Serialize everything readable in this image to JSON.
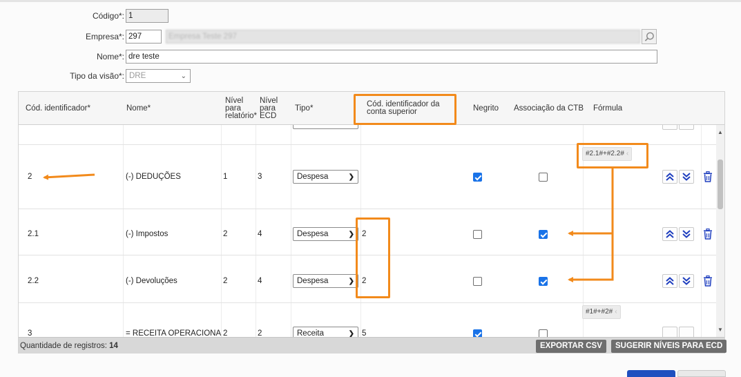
{
  "form": {
    "codigo": {
      "label": "Código*:",
      "value": "1"
    },
    "empresa": {
      "label": "Empresa*:",
      "code": "297",
      "name": "Empresa Teste 297"
    },
    "nome": {
      "label": "Nome*:",
      "value": "dre teste"
    },
    "tipo_visao": {
      "label": "Tipo da visão*:",
      "value": "DRE"
    }
  },
  "grid": {
    "columns": {
      "cod": "Cód. identificador*",
      "nome": "Nome*",
      "nivel_rel_1": "Nível",
      "nivel_rel_2": "para",
      "nivel_rel_3": "relatório*",
      "nivel_ecd_1": "Nível",
      "nivel_ecd_2": "para",
      "nivel_ecd_3": "ECD",
      "tipo": "Tipo*",
      "sup_1": "Cód. identificador da",
      "sup_2": "conta superior",
      "negrito": "Negrito",
      "assoc": "Associação da CTB",
      "formula": "Fórmula"
    },
    "rows": [
      {
        "cod": "2",
        "nome": "(-) DEDUÇÕES",
        "nivel_rel": "1",
        "nivel_ecd": "3",
        "tipo": "Despesa",
        "superior": "",
        "negrito": true,
        "assoc": false,
        "formula": "#2.1#+#2.2#"
      },
      {
        "cod": "2.1",
        "nome": "(-) Impostos",
        "nivel_rel": "2",
        "nivel_ecd": "4",
        "tipo": "Despesa",
        "superior": "2",
        "negrito": false,
        "assoc": true,
        "formula": ""
      },
      {
        "cod": "2.2",
        "nome": "(-) Devoluções",
        "nivel_rel": "2",
        "nivel_ecd": "4",
        "tipo": "Despesa",
        "superior": "2",
        "negrito": false,
        "assoc": true,
        "formula": ""
      },
      {
        "cod": "3",
        "nome": "= RECEITA OPERACIONA",
        "nivel_rel": "2",
        "nivel_ecd": "2",
        "tipo": "Receita",
        "superior": "5",
        "negrito": true,
        "assoc": false,
        "formula": "#1#+#2#"
      }
    ],
    "footer": {
      "count_label": "Quantidade de registros:",
      "count_value": "14",
      "export_btn": "EXPORTAR CSV",
      "suggest_btn": "SUGERIR NÍVEIS PARA ECD"
    }
  },
  "colors": {
    "accent": "#1a73e8",
    "annotation": "#f28a1b",
    "icon": "#1f3fbf"
  }
}
